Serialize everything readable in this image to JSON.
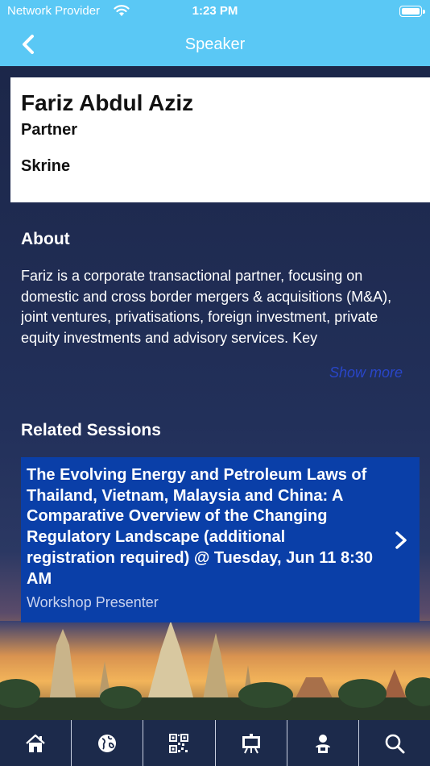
{
  "status_bar": {
    "carrier": "Network Provider",
    "time": "1:23 PM",
    "battery_level": 1.0
  },
  "header": {
    "title": "Speaker",
    "back_icon": "chevron-left-icon"
  },
  "speaker": {
    "name": "Fariz Abdul Aziz",
    "title": "Partner",
    "organization": "Skrine"
  },
  "about": {
    "heading": "About",
    "text": "Fariz is a corporate transactional partner, focusing on domestic and cross border mergers & acquisitions (M&A), joint ventures, privatisations, foreign investment, private equity investments and advisory services. Key",
    "show_more_label": "Show more"
  },
  "related_sessions": {
    "heading": "Related Sessions",
    "items": [
      {
        "title": "The Evolving Energy and Petroleum Laws of Thailand, Vietnam, Malaysia and China: A Comparative Overview of the Changing Regulatory Landscape (additional registration required) @ Tuesday, Jun 11 8:30 AM",
        "role": "Workshop Presenter"
      }
    ]
  },
  "tab_bar": {
    "tabs": [
      "home-icon",
      "globe-icon",
      "qr-code-icon",
      "presentation-icon",
      "speaker-icon",
      "search-icon"
    ]
  },
  "colors": {
    "header": "#5ac8f5",
    "background": "#1f2b4c",
    "session_card": "#0a3fa8",
    "show_more": "#2946c9"
  }
}
